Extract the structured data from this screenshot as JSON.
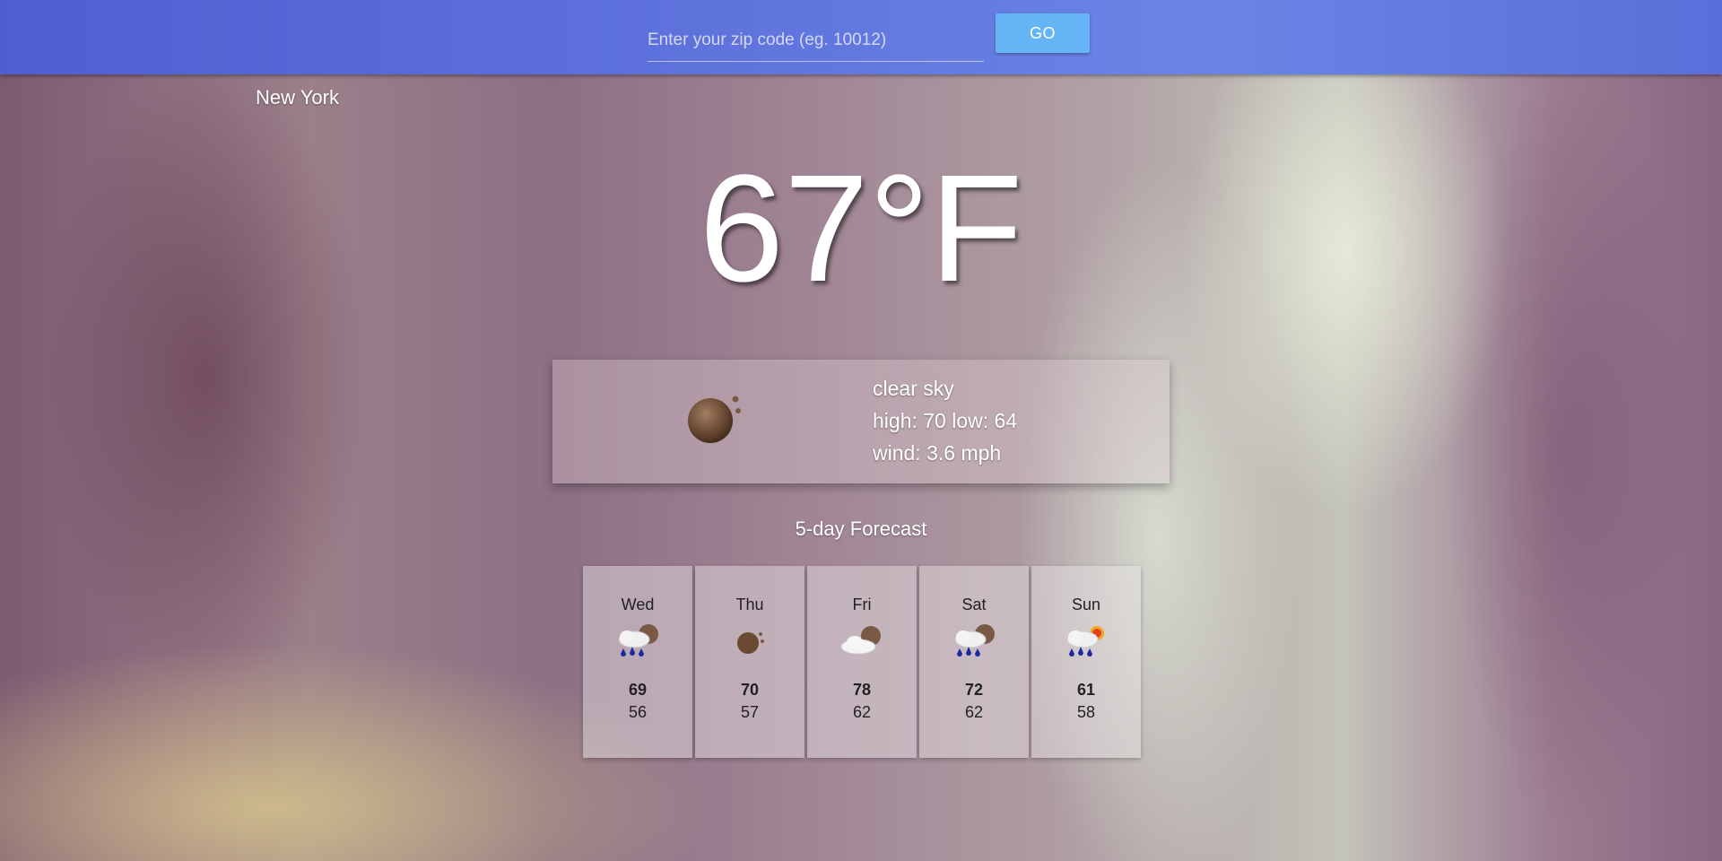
{
  "search": {
    "placeholder": "Enter your zip code (eg. 10012)",
    "value": "",
    "button_label": "GO"
  },
  "current": {
    "city": "New York",
    "temperature": "67°F",
    "icon": "moon-icon",
    "description": "clear sky",
    "high_low": "high: 70 low: 64",
    "wind": "wind: 3.6 mph"
  },
  "forecast": {
    "title": "5-day Forecast",
    "days": [
      {
        "day": "Wed",
        "icon": "night-rain-icon",
        "high": "69",
        "low": "56"
      },
      {
        "day": "Thu",
        "icon": "moon-icon",
        "high": "70",
        "low": "57"
      },
      {
        "day": "Fri",
        "icon": "night-cloud-icon",
        "high": "78",
        "low": "62"
      },
      {
        "day": "Sat",
        "icon": "night-rain-icon",
        "high": "72",
        "low": "62"
      },
      {
        "day": "Sun",
        "icon": "day-rain-icon",
        "high": "61",
        "low": "58"
      }
    ]
  },
  "colors": {
    "header": "#5e72dc",
    "button": "#64b4f6"
  }
}
